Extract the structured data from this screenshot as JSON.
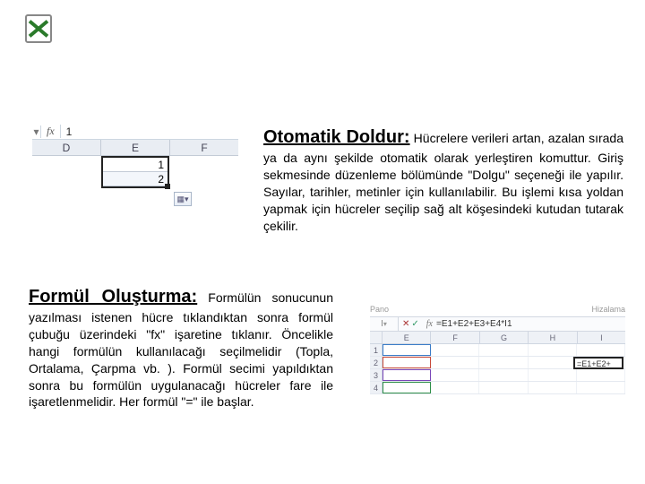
{
  "icon": {
    "name": "excel-icon"
  },
  "section1": {
    "title": "Otomatik Doldur:",
    "body": "Hücrelere verileri artan, azalan sırada ya da aynı şekilde otomatik olarak yerleştiren komuttur. Giriş sekmesinde düzenleme bölümünde \"Dolgu\" seçeneği ile yapılır. Sayılar, tarihler, metinler için kullanılabilir. Bu işlemi kısa yoldan yapmak için hücreler seçilip sağ alt köşesindeki kutudan tutarak çekilir."
  },
  "sheet1": {
    "formula_bar_value": "1",
    "fx_label": "fx",
    "columns": [
      "D",
      "E",
      "F"
    ],
    "selected_values": [
      "1",
      "2"
    ],
    "autofill_glyph": "▦▾"
  },
  "section2": {
    "title": "Formül Oluşturma:",
    "body": "Formülün sonucunun yazılması istenen hücre tıklandıktan sonra formül çubuğu üzerindeki \"fx\" işaretine tıklanır. Öncelikle hangi formülün kullanılacağı seçilmelidir (Topla, Ortalama, Çarpma vb. ). Formül secimi yapıldıktan sonra bu formülün uygulanacağı hücreler fare ile işaretlenmelidir. Her formül \"=\" ile başlar."
  },
  "sheet2": {
    "group_left": "Pano",
    "group_right": "Hizalama",
    "name_box": "I",
    "fx_label": "fx",
    "formula_text": "=E1+E2+E3+E4*I1",
    "btn_cancel": "✕",
    "btn_ok": "✓",
    "columns": [
      "E",
      "F",
      "G",
      "H",
      "I"
    ],
    "row_numbers": [
      "1",
      "2",
      "3",
      "4"
    ],
    "active_cell_text": "=E1+E2+"
  }
}
